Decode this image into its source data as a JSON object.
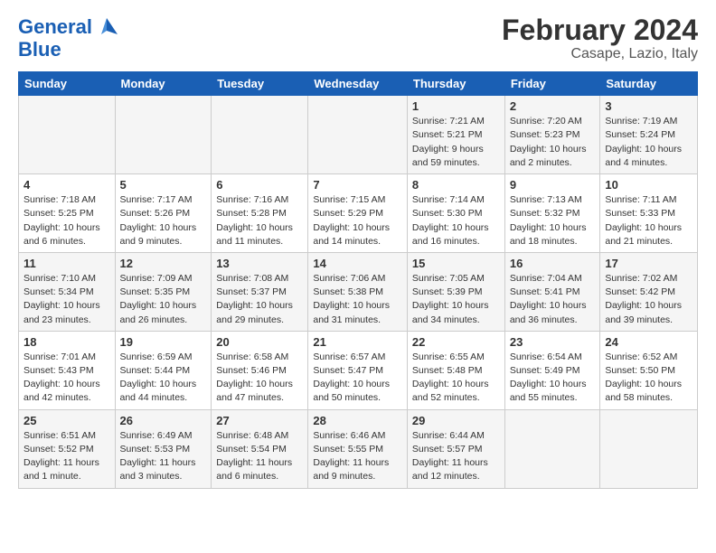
{
  "header": {
    "logo_general": "General",
    "logo_blue": "Blue",
    "title": "February 2024",
    "subtitle": "Casape, Lazio, Italy"
  },
  "weekdays": [
    "Sunday",
    "Monday",
    "Tuesday",
    "Wednesday",
    "Thursday",
    "Friday",
    "Saturday"
  ],
  "rows": [
    [
      {
        "day": "",
        "info": ""
      },
      {
        "day": "",
        "info": ""
      },
      {
        "day": "",
        "info": ""
      },
      {
        "day": "",
        "info": ""
      },
      {
        "day": "1",
        "info": "Sunrise: 7:21 AM\nSunset: 5:21 PM\nDaylight: 9 hours\nand 59 minutes."
      },
      {
        "day": "2",
        "info": "Sunrise: 7:20 AM\nSunset: 5:23 PM\nDaylight: 10 hours\nand 2 minutes."
      },
      {
        "day": "3",
        "info": "Sunrise: 7:19 AM\nSunset: 5:24 PM\nDaylight: 10 hours\nand 4 minutes."
      }
    ],
    [
      {
        "day": "4",
        "info": "Sunrise: 7:18 AM\nSunset: 5:25 PM\nDaylight: 10 hours\nand 6 minutes."
      },
      {
        "day": "5",
        "info": "Sunrise: 7:17 AM\nSunset: 5:26 PM\nDaylight: 10 hours\nand 9 minutes."
      },
      {
        "day": "6",
        "info": "Sunrise: 7:16 AM\nSunset: 5:28 PM\nDaylight: 10 hours\nand 11 minutes."
      },
      {
        "day": "7",
        "info": "Sunrise: 7:15 AM\nSunset: 5:29 PM\nDaylight: 10 hours\nand 14 minutes."
      },
      {
        "day": "8",
        "info": "Sunrise: 7:14 AM\nSunset: 5:30 PM\nDaylight: 10 hours\nand 16 minutes."
      },
      {
        "day": "9",
        "info": "Sunrise: 7:13 AM\nSunset: 5:32 PM\nDaylight: 10 hours\nand 18 minutes."
      },
      {
        "day": "10",
        "info": "Sunrise: 7:11 AM\nSunset: 5:33 PM\nDaylight: 10 hours\nand 21 minutes."
      }
    ],
    [
      {
        "day": "11",
        "info": "Sunrise: 7:10 AM\nSunset: 5:34 PM\nDaylight: 10 hours\nand 23 minutes."
      },
      {
        "day": "12",
        "info": "Sunrise: 7:09 AM\nSunset: 5:35 PM\nDaylight: 10 hours\nand 26 minutes."
      },
      {
        "day": "13",
        "info": "Sunrise: 7:08 AM\nSunset: 5:37 PM\nDaylight: 10 hours\nand 29 minutes."
      },
      {
        "day": "14",
        "info": "Sunrise: 7:06 AM\nSunset: 5:38 PM\nDaylight: 10 hours\nand 31 minutes."
      },
      {
        "day": "15",
        "info": "Sunrise: 7:05 AM\nSunset: 5:39 PM\nDaylight: 10 hours\nand 34 minutes."
      },
      {
        "day": "16",
        "info": "Sunrise: 7:04 AM\nSunset: 5:41 PM\nDaylight: 10 hours\nand 36 minutes."
      },
      {
        "day": "17",
        "info": "Sunrise: 7:02 AM\nSunset: 5:42 PM\nDaylight: 10 hours\nand 39 minutes."
      }
    ],
    [
      {
        "day": "18",
        "info": "Sunrise: 7:01 AM\nSunset: 5:43 PM\nDaylight: 10 hours\nand 42 minutes."
      },
      {
        "day": "19",
        "info": "Sunrise: 6:59 AM\nSunset: 5:44 PM\nDaylight: 10 hours\nand 44 minutes."
      },
      {
        "day": "20",
        "info": "Sunrise: 6:58 AM\nSunset: 5:46 PM\nDaylight: 10 hours\nand 47 minutes."
      },
      {
        "day": "21",
        "info": "Sunrise: 6:57 AM\nSunset: 5:47 PM\nDaylight: 10 hours\nand 50 minutes."
      },
      {
        "day": "22",
        "info": "Sunrise: 6:55 AM\nSunset: 5:48 PM\nDaylight: 10 hours\nand 52 minutes."
      },
      {
        "day": "23",
        "info": "Sunrise: 6:54 AM\nSunset: 5:49 PM\nDaylight: 10 hours\nand 55 minutes."
      },
      {
        "day": "24",
        "info": "Sunrise: 6:52 AM\nSunset: 5:50 PM\nDaylight: 10 hours\nand 58 minutes."
      }
    ],
    [
      {
        "day": "25",
        "info": "Sunrise: 6:51 AM\nSunset: 5:52 PM\nDaylight: 11 hours\nand 1 minute."
      },
      {
        "day": "26",
        "info": "Sunrise: 6:49 AM\nSunset: 5:53 PM\nDaylight: 11 hours\nand 3 minutes."
      },
      {
        "day": "27",
        "info": "Sunrise: 6:48 AM\nSunset: 5:54 PM\nDaylight: 11 hours\nand 6 minutes."
      },
      {
        "day": "28",
        "info": "Sunrise: 6:46 AM\nSunset: 5:55 PM\nDaylight: 11 hours\nand 9 minutes."
      },
      {
        "day": "29",
        "info": "Sunrise: 6:44 AM\nSunset: 5:57 PM\nDaylight: 11 hours\nand 12 minutes."
      },
      {
        "day": "",
        "info": ""
      },
      {
        "day": "",
        "info": ""
      }
    ]
  ]
}
